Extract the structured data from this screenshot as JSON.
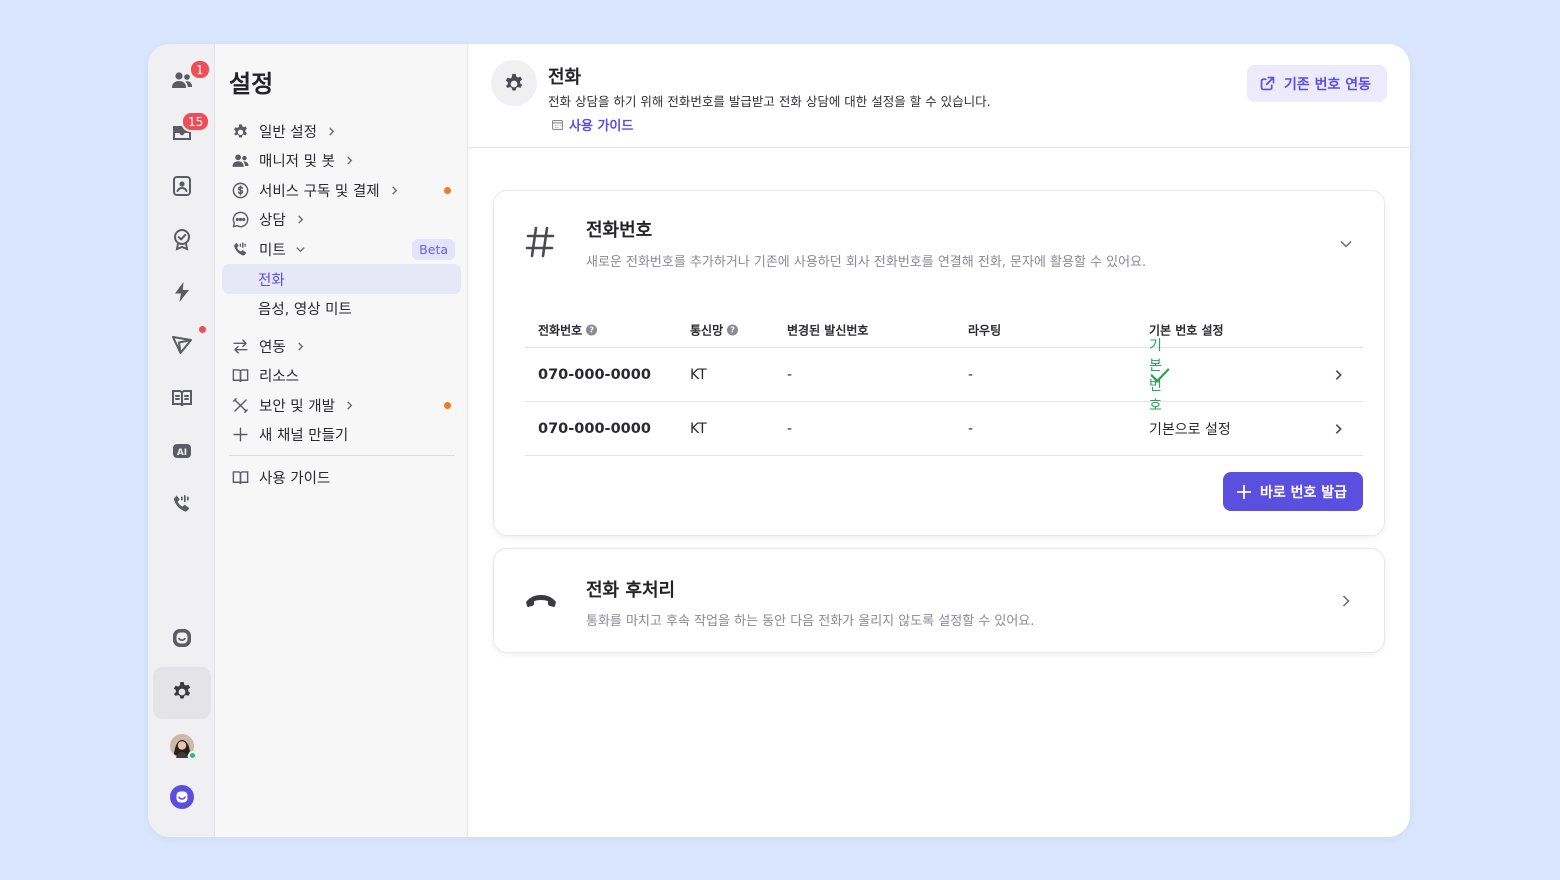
{
  "rail": {
    "badges": {
      "people": "1",
      "inbox": "15"
    },
    "icons": [
      "people-icon",
      "inbox-icon",
      "contacts-icon",
      "badge-check-icon",
      "bolt-icon",
      "send-icon",
      "book-icon",
      "ai-icon",
      "phone-icon",
      "chat-icon",
      "gear-icon",
      "avatar",
      "channel-logo-icon"
    ]
  },
  "nav": {
    "title": "설정",
    "items": [
      {
        "label": "일반 설정"
      },
      {
        "label": "매니저 및 봇"
      },
      {
        "label": "서비스 구독 및 결제"
      },
      {
        "label": "상담"
      },
      {
        "label": "미트",
        "badge": "Beta"
      },
      {
        "label": "전화"
      },
      {
        "label": "음성, 영상 미트"
      },
      {
        "label": "연동"
      },
      {
        "label": "리소스"
      },
      {
        "label": "보안 및 개발"
      },
      {
        "label": "새 채널 만들기"
      },
      {
        "label": "사용 가이드"
      }
    ]
  },
  "header": {
    "title": "전화",
    "description": "전화 상담을 하기 위해 전화번호를 발급받고 전화 상담에 대한 설정을 할 수 있습니다.",
    "guide_link": "사용 가이드",
    "link_button": "기존 번호 연동"
  },
  "phone_numbers": {
    "title": "전화번호",
    "description": "새로운 전화번호를 추가하거나 기존에 사용하던 회사 전화번호를 연결해 전화, 문자에 활용할 수 있어요.",
    "columns": [
      "전화번호",
      "통신망",
      "변경된 발신번호",
      "라우팅",
      "기본 번호 설정"
    ],
    "rows": [
      {
        "number": "070-000-0000",
        "carrier": "KT",
        "changed_caller": "-",
        "routing": "-",
        "default": "기본 번호",
        "is_default": true
      },
      {
        "number": "070-000-0000",
        "carrier": "KT",
        "changed_caller": "-",
        "routing": "-",
        "default": "기본으로 설정",
        "is_default": false
      }
    ],
    "issue_button": "바로 번호 발급"
  },
  "after_call": {
    "title": "전화 후처리",
    "description": "통화를 마치고 후속 작업을 하는 동안 다음 전화가 울리지 않도록 설정할 수 있어요."
  },
  "colors": {
    "accent": "#5b4fe0",
    "background": "#d9e6fd",
    "badge_red": "#ef4e58",
    "dot_orange": "#f4781c",
    "success_green": "#2aa356"
  }
}
